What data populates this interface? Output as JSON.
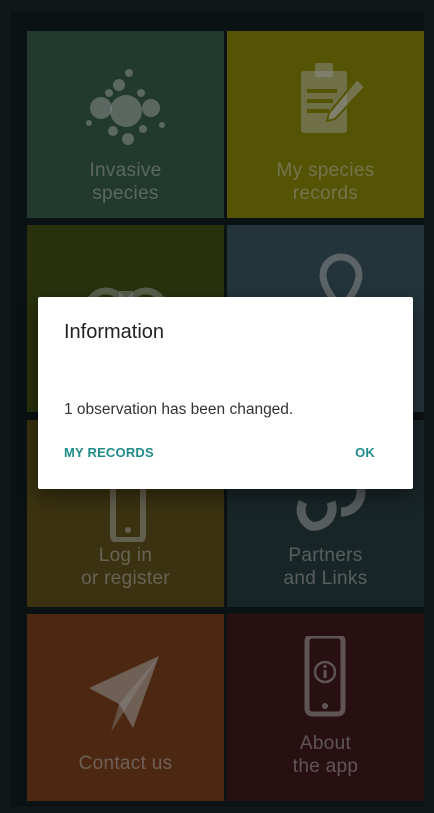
{
  "tiles": {
    "invasive_species": {
      "label_line1": "Invasive",
      "label_line2": "species",
      "color": "#3d6a52"
    },
    "my_species_records": {
      "label_line1": "My species",
      "label_line2": "records",
      "color": "#9a9a08"
    },
    "observe": {
      "color": "#4c5c18"
    },
    "map": {
      "color": "#40606c"
    },
    "log_in": {
      "label_line1": "Log in",
      "label_line2": "or register",
      "color": "#6b5b1e"
    },
    "partners": {
      "label_line1": "Partners",
      "label_line2": "and Links",
      "color": "#2c4448"
    },
    "contact": {
      "label_line1": "Contact us",
      "color": "#8a4a22"
    },
    "about": {
      "label_line1": "About",
      "label_line2": "the app",
      "color": "#4a1e22"
    }
  },
  "dialog": {
    "title": "Information",
    "message": "1 observation has been changed.",
    "secondary_button": "MY RECORDS",
    "primary_button": "OK",
    "accent_color": "#1f8c8a"
  }
}
